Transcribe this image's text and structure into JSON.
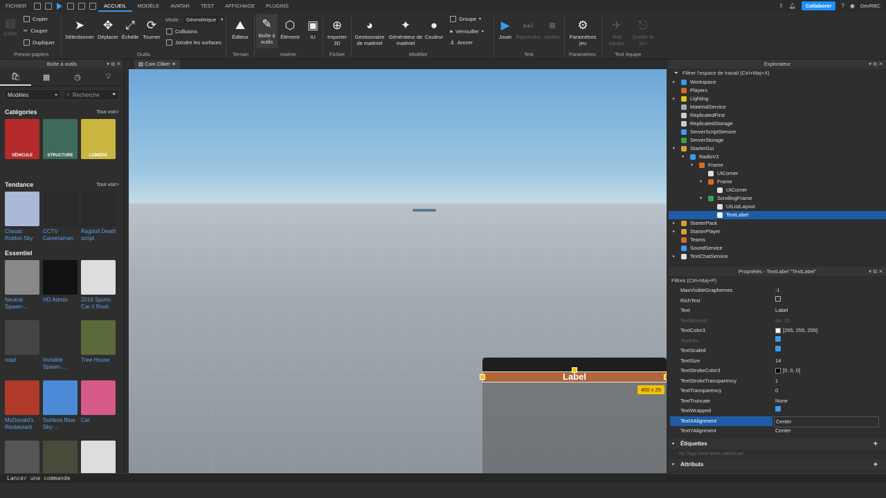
{
  "menubar": {
    "items": [
      "FICHIER",
      "ACCUEIL",
      "MODÈLE",
      "AVATAR",
      "TEST",
      "AFFICHAGE",
      "PLUGINS"
    ],
    "collaborate": "Collaborer",
    "user": "DevRBC"
  },
  "ribbon": {
    "clipboard": {
      "copy": "Copier",
      "cut": "Couper",
      "duplicate": "Dupliquer",
      "paste": "Coller",
      "group": "Presse-papiers"
    },
    "tools": {
      "select": "Sélectionner",
      "move": "Déplacer",
      "scale": "Échelle",
      "rotate": "Tourner",
      "mode_label": "Mode :",
      "mode_value": "Géométrique",
      "collisions": "Collisions",
      "join": "Joindre les surfaces",
      "group": "Outils"
    },
    "terrain": {
      "editor": "Éditeur",
      "group": "Terrain"
    },
    "insert": {
      "toolbox": "Boîte à outils",
      "element": "Élément",
      "ui": "IU",
      "group": "Insérer"
    },
    "file": {
      "import3d": "Importer 3D",
      "group": "Fichier"
    },
    "modify": {
      "material": "Gestionnaire de matériel",
      "matgen": "Générateur de matériel",
      "color": "Couleur",
      "groupe": "Groupe",
      "lock": "Verrouiller",
      "anchor": "Ancrer",
      "group": "Modifier"
    },
    "test": {
      "play": "Jouer",
      "resume": "Reprendre",
      "stop": "Arrêter",
      "group": "Test"
    },
    "settings": {
      "game": "Paramètres jeu",
      "group": "Paramètres"
    },
    "team": {
      "team_test": "Test équipe",
      "quit": "Quitter le jeu",
      "group": "Test équipe"
    }
  },
  "toolbox": {
    "title": "Boîte à outils",
    "dropdown": "Modèles",
    "search_placeholder": "Recherche",
    "categories_title": "Catégories",
    "see_all": "Tout voir>",
    "categories": [
      {
        "label": "VÉHICULE",
        "color": "#b52a2a"
      },
      {
        "label": "STRUCTURE",
        "color": "#3d6a5a"
      },
      {
        "label": "LUMIÈRE",
        "color": "#c9b540"
      }
    ],
    "trending_title": "Tendance",
    "trending": [
      {
        "name": "Classic Roblox Sky",
        "color": "#a9b9d6"
      },
      {
        "name": "CCTV Cameraman",
        "color": "#2a2a2a"
      },
      {
        "name": "Ragdoll Death script",
        "color": "#2a2a2a"
      }
    ],
    "essential_title": "Essentiel",
    "essential": [
      {
        "name": "Neutral Spawn-...",
        "color": "#888888"
      },
      {
        "name": "HD Admin",
        "color": "#111111"
      },
      {
        "name": "2019 Sports Car // Rosh",
        "color": "#dddddd"
      },
      {
        "name": "road",
        "color": "#444444"
      },
      {
        "name": "Invisible Spawn-...",
        "color": "#2e2e2e"
      },
      {
        "name": "Tree House",
        "color": "#5a6a3a"
      },
      {
        "name": "McDonald's Restaurant",
        "color": "#b03a2a"
      },
      {
        "name": "Sunless Blue Sky-...",
        "color": "#4a8ad6"
      },
      {
        "name": "Car",
        "color": "#d65a8a"
      },
      {
        "name": "",
        "color": "#555555"
      },
      {
        "name": "",
        "color": "#4a4a3a"
      },
      {
        "name": "",
        "color": "#dddddd"
      }
    ]
  },
  "viewport": {
    "tab": "Coin Cliker",
    "label_text": "Label",
    "size_tag": "400 x 25"
  },
  "explorer": {
    "title": "Explorateur",
    "filter": "Filtrer l'espace de travail (Ctrl+Maj+X)",
    "items": [
      {
        "name": "Workspace",
        "depth": 0,
        "arrow": "▸",
        "color": "#3b9af0"
      },
      {
        "name": "Players",
        "depth": 0,
        "arrow": "",
        "color": "#d66a2a"
      },
      {
        "name": "Lighting",
        "depth": 0,
        "arrow": "▸",
        "color": "#e0c020"
      },
      {
        "name": "MaterialService",
        "depth": 0,
        "arrow": "",
        "color": "#aaaaaa"
      },
      {
        "name": "ReplicatedFirst",
        "depth": 0,
        "arrow": "",
        "color": "#cccccc"
      },
      {
        "name": "ReplicatedStorage",
        "depth": 0,
        "arrow": "",
        "color": "#cccccc"
      },
      {
        "name": "ServerScriptService",
        "depth": 0,
        "arrow": "",
        "color": "#3b9af0"
      },
      {
        "name": "ServerStorage",
        "depth": 0,
        "arrow": "",
        "color": "#3aa04a"
      },
      {
        "name": "StarterGui",
        "depth": 0,
        "arrow": "▾",
        "color": "#d6a03a"
      },
      {
        "name": "RadioV2",
        "depth": 1,
        "arrow": "▾",
        "color": "#3b9af0"
      },
      {
        "name": "Frame",
        "depth": 2,
        "arrow": "▾",
        "color": "#d66a2a"
      },
      {
        "name": "UICorner",
        "depth": 3,
        "arrow": "",
        "color": "#dddddd"
      },
      {
        "name": "Frame",
        "depth": 3,
        "arrow": "▾",
        "color": "#d66a2a"
      },
      {
        "name": "UICorner",
        "depth": 4,
        "arrow": "",
        "color": "#dddddd"
      },
      {
        "name": "ScrollingFrame",
        "depth": 3,
        "arrow": "▾",
        "color": "#3aa04a"
      },
      {
        "name": "UIListLayout",
        "depth": 4,
        "arrow": "",
        "color": "#dddddd"
      },
      {
        "name": "TextLabel",
        "depth": 4,
        "arrow": "",
        "color": "#ffffff",
        "selected": true
      },
      {
        "name": "StarterPack",
        "depth": 0,
        "arrow": "▸",
        "color": "#d6a03a"
      },
      {
        "name": "StarterPlayer",
        "depth": 0,
        "arrow": "▸",
        "color": "#d6a03a"
      },
      {
        "name": "Teams",
        "depth": 0,
        "arrow": "",
        "color": "#d66a2a"
      },
      {
        "name": "SoundService",
        "depth": 0,
        "arrow": "",
        "color": "#3b9af0"
      },
      {
        "name": "TextChatService",
        "depth": 0,
        "arrow": "▸",
        "color": "#dddddd"
      }
    ]
  },
  "properties": {
    "title": "Propriétés - TextLabel \"TextLabel\"",
    "filter": "Filtres (Ctrl+Maj+P)",
    "rows": [
      {
        "name": "MaxVisibleGraphemes",
        "value": "-1"
      },
      {
        "name": "RichText",
        "value": "",
        "check": "off"
      },
      {
        "name": "Text",
        "value": "Label"
      },
      {
        "name": "TextBounds",
        "value": "64, 25",
        "dim": true
      },
      {
        "name": "TextColor3",
        "value": "[255, 255, 255]",
        "swatch": "#ffffff"
      },
      {
        "name": "TextFits",
        "value": "",
        "check": "on",
        "dim": true
      },
      {
        "name": "TextScaled",
        "value": "",
        "check": "on"
      },
      {
        "name": "TextSize",
        "value": "14"
      },
      {
        "name": "TextStrokeColor3",
        "value": "[0, 0, 0]",
        "swatch": "#000000"
      },
      {
        "name": "TextStrokeTransparency",
        "value": "1"
      },
      {
        "name": "TextTransparency",
        "value": "0"
      },
      {
        "name": "TextTruncate",
        "value": "None"
      },
      {
        "name": "TextWrapped",
        "value": "",
        "check": "on"
      },
      {
        "name": "TextXAlignment",
        "value": "Center",
        "highlight": true
      },
      {
        "name": "TextYAlignment",
        "value": "Center"
      }
    ],
    "tags_title": "Étiquettes",
    "tags_empty": "No Tags have been added yet",
    "attributes_title": "Attributs"
  },
  "command": {
    "placeholder": "Lancer une commande"
  }
}
